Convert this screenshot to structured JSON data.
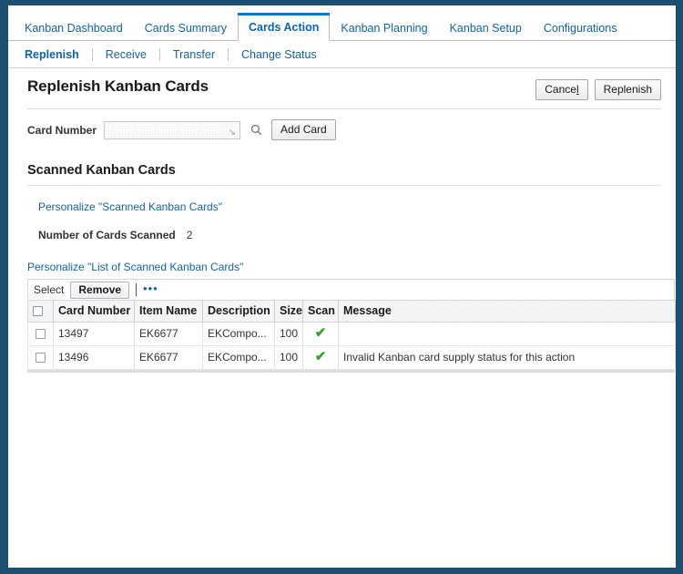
{
  "window": {
    "frame_color": "#1d4f70",
    "accent_color": "#0b78d0",
    "link_color": "#15639e",
    "success_color": "#3c9c32"
  },
  "main_tabs": [
    {
      "label": "Kanban Dashboard",
      "active": false
    },
    {
      "label": "Cards Summary",
      "active": false
    },
    {
      "label": "Cards Action",
      "active": true
    },
    {
      "label": "Kanban Planning",
      "active": false
    },
    {
      "label": "Kanban Setup",
      "active": false
    },
    {
      "label": "Configurations",
      "active": false
    }
  ],
  "sub_tabs": [
    {
      "label": "Replenish",
      "active": true
    },
    {
      "label": "Receive",
      "active": false
    },
    {
      "label": "Transfer",
      "active": false
    },
    {
      "label": "Change Status",
      "active": false
    }
  ],
  "header": {
    "title": "Replenish Kanban Cards",
    "cancel_label": "Cance",
    "cancel_accel": "l",
    "replenish_label": "Replenish"
  },
  "card_entry": {
    "label": "Card Number",
    "value": "",
    "placeholder": "",
    "resize_glyph": "↘",
    "search_icon": "search-icon",
    "add_card_label": "Add Card"
  },
  "scanned_section": {
    "title": "Scanned Kanban Cards",
    "personalize_link": "Personalize \"Scanned Kanban Cards\"",
    "count_label": "Number of Cards Scanned",
    "count_value": "2"
  },
  "list_section": {
    "personalize_link": "Personalize \"List of Scanned Kanban Cards\"",
    "toolbar": {
      "select_label": "Select",
      "remove_label": "Remove",
      "more_label": "•••"
    },
    "columns": [
      "Card Number",
      "Item Name",
      "Description",
      "Size",
      "Scan",
      "Message"
    ],
    "rows": [
      {
        "selected": false,
        "card_number": "13497",
        "item_name": "EK6677",
        "description": "EKCompo...",
        "size": "100",
        "scan": "✔",
        "message": ""
      },
      {
        "selected": false,
        "card_number": "13496",
        "item_name": "EK6677",
        "description": "EKCompo...",
        "size": "100",
        "scan": "✔",
        "message": "Invalid Kanban card supply status for this action"
      }
    ]
  }
}
